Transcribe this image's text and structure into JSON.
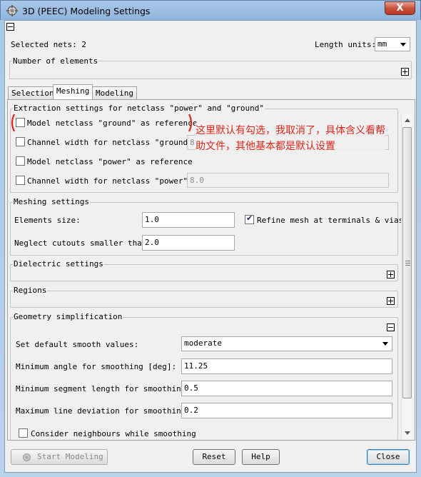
{
  "window": {
    "title": "3D (PEEC) Modeling Settings",
    "close_label": "X"
  },
  "header": {
    "selected_nets": "Selected nets: 2",
    "length_units_label": "Length units:",
    "length_units_value": "mm",
    "number_of_elements": "Number of elements"
  },
  "tabs": [
    {
      "label": "Selection",
      "active": false
    },
    {
      "label": "Meshing",
      "active": true
    },
    {
      "label": "Modeling",
      "active": false
    }
  ],
  "extraction": {
    "legend": "Extraction settings for netclass \"power\" and \"ground\"",
    "model_ground": {
      "label": "Model netclass \"ground\" as reference",
      "checked": false
    },
    "channel_ground": {
      "label": "Channel width for netclass \"ground\":",
      "value": "8.",
      "checked": false
    },
    "model_power": {
      "label": "Model netclass \"power\" as reference",
      "checked": false
    },
    "channel_power": {
      "label": "Channel width for netclass \"power\":",
      "value": "8.0",
      "checked": false
    }
  },
  "annotation": {
    "line1": "这里默认有勾选，我取消了，具体含义看帮",
    "line2": "助文件，其他基本都是默认设置",
    "color": "#e0261c"
  },
  "meshing": {
    "legend": "Meshing settings",
    "elements_size_label": "Elements size:",
    "elements_size_value": "1.0",
    "refine_label": "Refine mesh at terminals & vias",
    "refine_checked": true,
    "neglect_label": "Neglect cutouts smaller than:",
    "neglect_value": "2.0"
  },
  "dielectric": {
    "legend": "Dielectric settings"
  },
  "regions": {
    "legend": "Regions"
  },
  "geometry": {
    "legend": "Geometry simplification",
    "smooth_label": "Set default smooth values:",
    "smooth_value": "moderate",
    "min_angle_label": "Minimum angle for smoothing [deg]:",
    "min_angle_value": "11.25",
    "min_segment_label": "Minimum segment length for smoothing:",
    "min_segment_value": "0.5",
    "max_dev_label": "Maximum line deviation for smoothing:",
    "max_dev_value": "0.2",
    "neighbours_label": "Consider neighbours while smoothing",
    "neighbours_checked": false
  },
  "footer": {
    "start_label": "Start Modeling",
    "reset_label": "Reset",
    "help_label": "Help",
    "close_label": "Close"
  }
}
